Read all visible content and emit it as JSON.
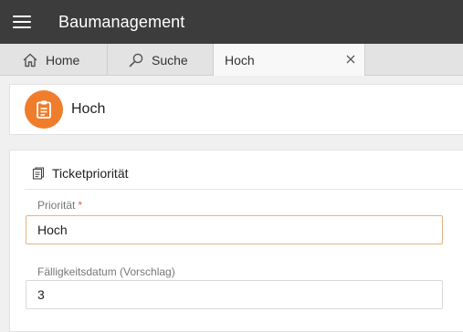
{
  "app": {
    "title": "Baumanagement"
  },
  "tabs": [
    {
      "label": "Home",
      "icon": "home-icon"
    },
    {
      "label": "Suche",
      "icon": "search-icon"
    },
    {
      "label": "Hoch",
      "icon": "close-icon",
      "active": true
    }
  ],
  "header": {
    "title": "Hoch",
    "icon": "clipboard-icon"
  },
  "section": {
    "title": "Ticketpriorität",
    "icon": "document-icon"
  },
  "fields": [
    {
      "label": "Priorität",
      "required_marker": "*",
      "value": "Hoch"
    },
    {
      "label": "Fälligkeitsdatum (Vorschlag)",
      "value": "3"
    }
  ],
  "colors": {
    "topbar": "#3c3c3c",
    "accent": "#ef7d2c",
    "required": "#e05b4a"
  }
}
